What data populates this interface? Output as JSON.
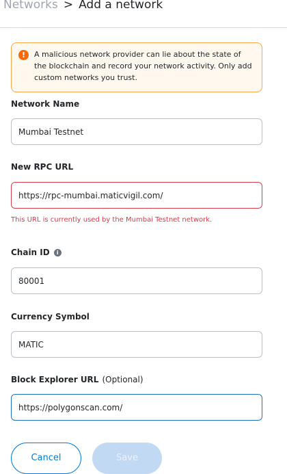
{
  "breadcrumb": {
    "parent": "Networks",
    "separator": ">",
    "current": "Add a network"
  },
  "warning": {
    "icon": "exclamation-icon",
    "text": "A malicious network provider can lie about the state of the blockchain and record your network activity. Only add custom networks you trust."
  },
  "form": {
    "network_name": {
      "label": "Network Name",
      "value": "Mumbai Testnet"
    },
    "rpc_url": {
      "label": "New RPC URL",
      "value": "https://rpc-mumbai.maticvigil.com/",
      "error": "This URL is currently used by the Mumbai Testnet network."
    },
    "chain_id": {
      "label": "Chain ID",
      "info_icon": "i",
      "value": "80001"
    },
    "currency_symbol": {
      "label": "Currency Symbol",
      "value": "MATIC"
    },
    "block_explorer": {
      "label": "Block Explorer URL",
      "optional": "(Optional)",
      "value": "https://polygonscan.com/"
    }
  },
  "actions": {
    "cancel_label": "Cancel",
    "save_label": "Save"
  },
  "colors": {
    "primary": "#037dd6",
    "error": "#d73a49",
    "warning_border": "#f8a84a",
    "warning_bg": "#fef8ee"
  }
}
